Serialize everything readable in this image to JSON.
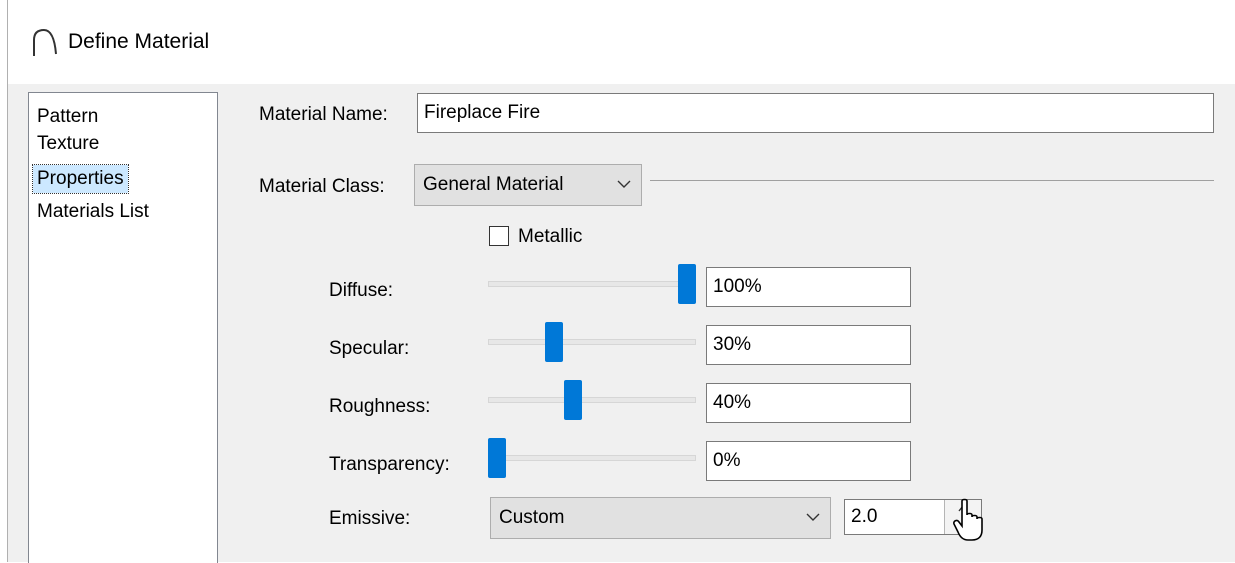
{
  "window": {
    "title": "Define Material"
  },
  "nav": {
    "items": [
      "Pattern",
      "Texture",
      "Properties",
      "Materials List"
    ],
    "selected_index": 2
  },
  "material_name": {
    "label": "Material Name:",
    "value": "Fireplace Fire"
  },
  "material_class": {
    "label": "Material Class:",
    "value": "General Material"
  },
  "metallic": {
    "label": "Metallic",
    "checked": false
  },
  "properties": [
    {
      "label": "Diffuse:",
      "value": "100%",
      "level": 1.0
    },
    {
      "label": "Specular:",
      "value": "30%",
      "level": 0.3
    },
    {
      "label": "Roughness:",
      "value": "40%",
      "level": 0.4
    },
    {
      "label": "Transparency:",
      "value": "0%",
      "level": 0.0
    }
  ],
  "emissive": {
    "label": "Emissive:",
    "mode": "Custom",
    "value": "2.0"
  },
  "colors": {
    "accent": "#0078d7",
    "selection": "#cce8ff",
    "dialog_bg": "#f0f0f0"
  }
}
